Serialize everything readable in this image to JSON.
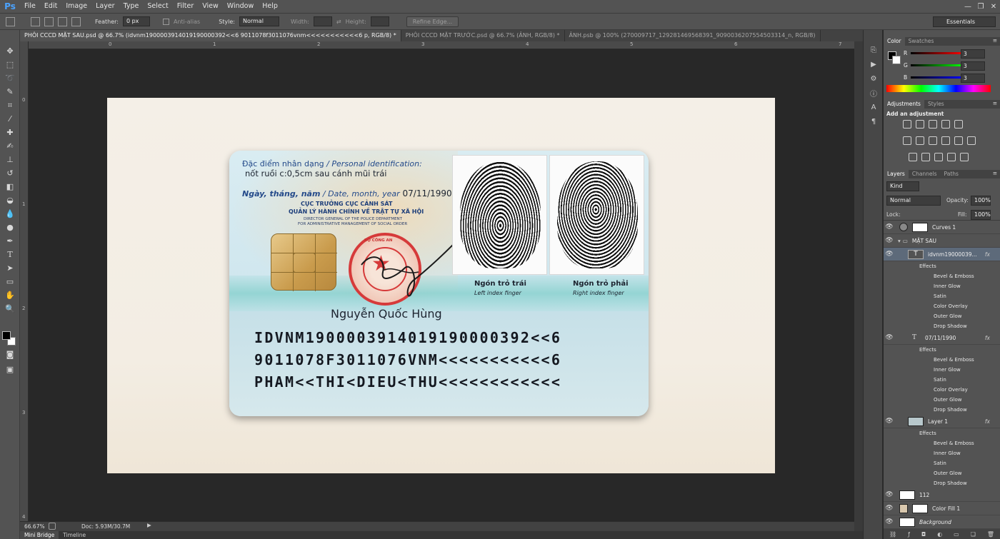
{
  "app": {
    "logo": "Ps"
  },
  "menu": [
    "File",
    "Edit",
    "Image",
    "Layer",
    "Type",
    "Select",
    "Filter",
    "View",
    "Window",
    "Help"
  ],
  "window_controls": {
    "minimize": "—",
    "restore": "❐",
    "close": "✕"
  },
  "options": {
    "feather_label": "Feather:",
    "feather_value": "0 px",
    "antialias_label": "Anti-alias",
    "style_label": "Style:",
    "style_value": "Normal",
    "width_label": "Width:",
    "height_label": "Height:",
    "refine_edge": "Refine Edge...",
    "workspace": "Essentials"
  },
  "tabs": [
    "PHÔI CCCD MẶT SAU.psd @ 66.7% (idvnm190000391401919000039​2<<6 9011078f3011076vnm<<<<<<<<<<<6 p, RGB/8) *",
    "PHÔI CCCD MẶT TRƯỚC.psd @ 66.7% (ẢNH, RGB/8) *",
    "ẢNH.psb @ 100% (270009717_129281469568391_9090036207554503314_n, RGB/8)"
  ],
  "ruler_h": [
    "0",
    "1",
    "2",
    "3",
    "4",
    "5",
    "6",
    "7"
  ],
  "ruler_v": [
    "0",
    "1",
    "2",
    "3",
    "4"
  ],
  "card": {
    "ident_label_vn": "Đặc điểm nhân dạng",
    "ident_label_en": " / Personal identification:",
    "ident_value": "nốt ruồi c:0,5cm sau cánh mũi trái",
    "date_label_vn": "Ngày, tháng, năm",
    "date_label_en": " / Date, month, year",
    "date_value": "07/11/1990",
    "issuer_line1": "CỤC TRƯỞNG CỤC CẢNH SÁT",
    "issuer_line2": "QUẢN LÝ HÀNH CHÍNH VỀ TRẬT TỰ XÃ HỘI",
    "issuer_en1": "DIRECTOR GENERAL OF THE POLICE DEPARTMENT",
    "issuer_en2": "FOR ADMINISTRATIVE MANAGEMENT OF SOCIAL ORDER",
    "seal_text": "BỘ CÔNG AN",
    "signer": "Nguyễn Quốc Hùng",
    "left_finger_vn": "Ngón trỏ trái",
    "left_finger_en": "Left index finger",
    "right_finger_vn": "Ngón trỏ phải",
    "right_finger_en": "Right index finger",
    "mrz1": "IDVNM190000391401919000039​2<<6",
    "mrz2": "9011078F3011076VNM<<<<<<<<<<<6",
    "mrz3": "PHAM<<THI<DIEU<THU<<<<<<<<<<<<"
  },
  "status": {
    "zoom": "66.67%",
    "doc": "Doc: 5.93M/30.7M"
  },
  "bottom_tabs": [
    "Mini Bridge",
    "Timeline"
  ],
  "color_panel": {
    "tabs": [
      "Color",
      "Swatches"
    ],
    "r_label": "R",
    "r_value": "3",
    "g_label": "G",
    "g_value": "3",
    "b_label": "B",
    "b_value": "3"
  },
  "adjust_panel": {
    "tabs": [
      "Adjustments",
      "Styles"
    ],
    "heading": "Add an adjustment"
  },
  "layers_panel": {
    "tabs": [
      "Layers",
      "Channels",
      "Paths"
    ],
    "kind": "Kind",
    "blend": "Normal",
    "opacity_label": "Opacity:",
    "opacity": "100%",
    "lock_label": "Lock:",
    "fill_label": "Fill:",
    "fill": "100%",
    "fx": "fx",
    "effects_label": "Effects",
    "layers": [
      {
        "name": "Curves 1"
      },
      {
        "name": "MẶT SAU"
      },
      {
        "name": "idvnm19000039...",
        "effects": [
          "Bevel & Emboss",
          "Inner Glow",
          "Satin",
          "Color Overlay",
          "Outer Glow",
          "Drop Shadow"
        ]
      },
      {
        "name": "07/11/1990",
        "effects": [
          "Bevel & Emboss",
          "Inner Glow",
          "Satin",
          "Color Overlay",
          "Outer Glow",
          "Drop Shadow"
        ]
      },
      {
        "name": "Layer 1",
        "effects": [
          "Bevel & Emboss",
          "Inner Glow",
          "Satin",
          "Outer Glow",
          "Drop Shadow"
        ]
      },
      {
        "name": "112"
      },
      {
        "name": "Color Fill 1"
      },
      {
        "name": "Background"
      }
    ]
  },
  "colors": {
    "ui": "#535353",
    "canvas": "#282828",
    "ps_blue": "#4ba3ff",
    "seal_red": "#d63a3a"
  }
}
